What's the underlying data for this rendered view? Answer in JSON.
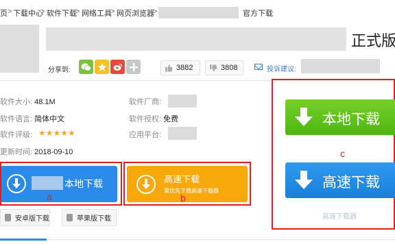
{
  "breadcrumb": {
    "home": "页",
    "sep": ">",
    "items": [
      "下载中心",
      "软件下载",
      "网络工具",
      "网页浏览器"
    ],
    "current_suffix": "官方下载"
  },
  "title": {
    "suffix": "正式版"
  },
  "share": {
    "label": "分享到:",
    "icons": [
      "wechat-icon",
      "qzone-star-icon",
      "weibo-icon",
      "more-plus-icon"
    ],
    "colors": {
      "wechat": "#7bc142",
      "qzone": "#f5c021",
      "weibo": "#e9483c",
      "more": "#c8c8c8"
    }
  },
  "votes": {
    "up": "3882",
    "down": "3808"
  },
  "suggestion": {
    "label": "投诉建议:"
  },
  "info": {
    "size_label": "软件大小:",
    "size_value": "48.1M",
    "lang_label": "软件语言:",
    "lang_value": "简体中文",
    "rating_label": "软件评级:",
    "rating_stars": "★★★★★",
    "update_label": "更新时间:",
    "update_value": "2018-09-10",
    "vendor_label": "软件厂商:",
    "license_label": "软件授权:",
    "license_value": "免费",
    "platform_label": "应用平台:"
  },
  "buttons": {
    "local_download": "本地下载",
    "fast_download": "高速下载",
    "fast_download_sub": "需优先下载高速下载器",
    "android": "安卓版下载",
    "apple": "苹果版下载",
    "big_local": "本地下载",
    "big_fast": "高速下载",
    "downloader_text": "高速下载器"
  },
  "annotations": {
    "a": "a",
    "b": "b",
    "c": "c"
  },
  "colors": {
    "accent_blue": "#2c8be8",
    "accent_orange": "#f7a80b",
    "accent_green": "#5cbf1c",
    "annotation_red": "#e02020"
  }
}
